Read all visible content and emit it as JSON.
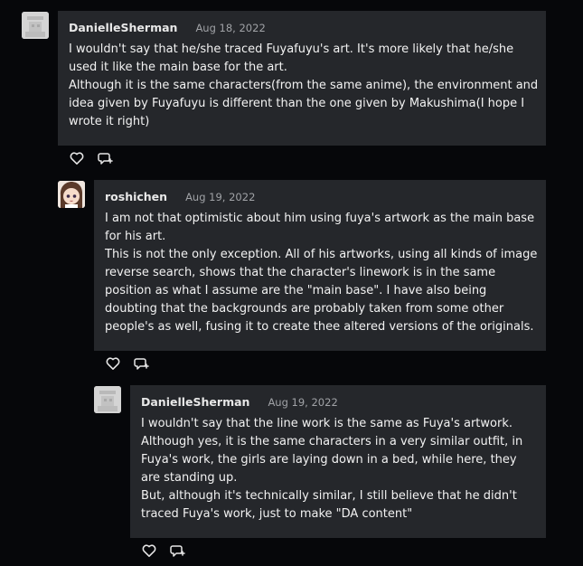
{
  "comments": [
    {
      "author": "DanielleSherman",
      "date": "Aug 18, 2022",
      "lines": [
        "I wouldn't say that he/she traced Fuyafuyu's art. It's more likely that he/she used it like the main base for the art.",
        "Although it is the same characters(from the same anime), the environment and idea given by Fuyafuyu is different than the one given by Makushima(I hope I wrote it right)"
      ],
      "avatar_icon": "deviantart-default-avatar-icon"
    },
    {
      "author": "roshichen",
      "date": "Aug 19, 2022",
      "lines": [
        "I am not that optimistic about him using fuya's artwork as the main base for his art.",
        "This is not the only exception. All of his artworks, using all kinds of image reverse search, shows that the character's linework is in the same position as what I assume are the \"main base\". I have also being doubting that the backgrounds are probably taken from some other people's as well, fusing it to create thee altered versions of the originals."
      ],
      "avatar_icon": "anime-character-avatar-icon"
    },
    {
      "author": "DanielleSherman",
      "date": "Aug 19, 2022",
      "lines": [
        "I wouldn't say that the line work is the same as Fuya's artwork.",
        "Although yes, it is the same characters in a very similar outfit, in Fuya's work, the girls are laying down in a bed, while here, they are standing up.",
        "But, although it's technically similar, I still believe that he didn't traced Fuya's work, just to make \"DA content\""
      ],
      "avatar_icon": "deviantart-default-avatar-icon"
    }
  ],
  "icons": {
    "like": "heart-icon",
    "reply": "reply-speech-bubble-icon"
  },
  "colors": {
    "background": "#06070a",
    "bubble": "#25272b",
    "text": "#f2f2f2",
    "date": "#a0a2a6"
  }
}
